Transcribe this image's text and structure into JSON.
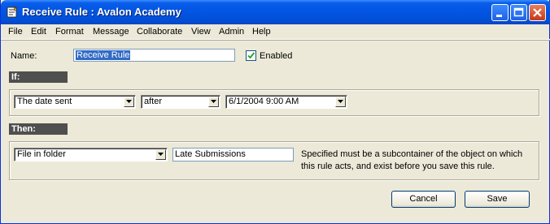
{
  "window": {
    "title": "Receive Rule : Avalon Academy"
  },
  "menu": [
    "File",
    "Edit",
    "Format",
    "Message",
    "Collaborate",
    "View",
    "Admin",
    "Help"
  ],
  "name_field": {
    "label": "Name:",
    "value": "Receive Rule"
  },
  "enabled": {
    "label": "Enabled",
    "checked": true
  },
  "if_section": {
    "header": "If:",
    "field": "The date sent",
    "operator": "after",
    "date_value": "6/1/2004 9:00 AM"
  },
  "then_section": {
    "header": "Then:",
    "action": "File in folder",
    "folder": "Late Submissions",
    "note": "Specified must be a subcontainer of the object on which this rule acts, and  exist before you save this rule."
  },
  "buttons": {
    "cancel": "Cancel",
    "save": "Save"
  },
  "colors": {
    "titlebar": "#0355e3",
    "section_header": "#4f4f4f",
    "selection": "#316ac5",
    "window_bg": "#ece9d8"
  }
}
